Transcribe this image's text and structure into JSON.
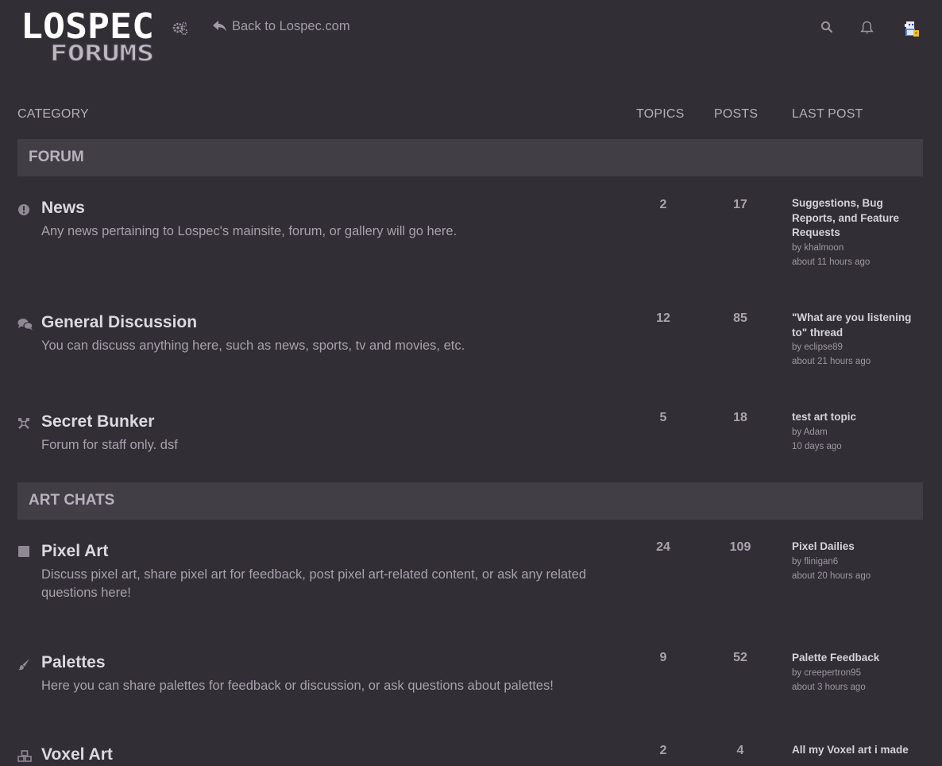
{
  "header": {
    "logo_line1": "LOSPEC",
    "logo_line2": "FORUMS",
    "back_label": "Back to Lospec.com",
    "icons": [
      "settings-icon",
      "search-icon",
      "bell-icon",
      "avatar"
    ]
  },
  "columns": {
    "category": "CATEGORY",
    "topics": "TOPICS",
    "posts": "POSTS",
    "last_post": "LAST POST"
  },
  "sections": [
    {
      "name": "FORUM",
      "categories": [
        {
          "icon": "exclamation-circle-icon",
          "title": "News",
          "description": "Any news pertaining to Lospec's mainsite, forum, or gallery will go here.",
          "topics": "2",
          "posts": "17",
          "last_post": {
            "title": "Suggestions, Bug Reports, and Feature Requests",
            "by": "by",
            "user": "khalmoon",
            "time": "about 11 hours ago"
          }
        },
        {
          "icon": "chat-bubbles-icon",
          "title": "General Discussion",
          "description": "You can discuss anything here, such as news, sports, tv and movies, etc.",
          "topics": "12",
          "posts": "85",
          "last_post": {
            "title": "\"What are you listening to\" thread",
            "by": "by",
            "user": "eclipse89",
            "time": "about 21 hours ago"
          }
        },
        {
          "icon": "crossed-tools-icon",
          "title": "Secret Bunker",
          "description": "Forum for staff only. dsf",
          "topics": "5",
          "posts": "18",
          "last_post": {
            "title": "test art topic",
            "by": "by",
            "user": "Adam",
            "time": "10 days ago"
          }
        }
      ]
    },
    {
      "name": "ART CHATS",
      "categories": [
        {
          "icon": "square-icon",
          "title": "Pixel Art",
          "description": "Discuss pixel art, share pixel art for feedback, post pixel art-related content, or ask any related questions here!",
          "topics": "24",
          "posts": "109",
          "last_post": {
            "title": "Pixel Dailies",
            "by": "by",
            "user": "flinigan6",
            "time": "about 20 hours ago"
          }
        },
        {
          "icon": "paintbrush-icon",
          "title": "Palettes",
          "description": "Here you can share palettes for feedback or discussion, or ask questions about palettes!",
          "topics": "9",
          "posts": "52",
          "last_post": {
            "title": "Palette Feedback",
            "by": "by",
            "user": "creepertron95",
            "time": "about 3 hours ago"
          }
        },
        {
          "icon": "cubes-icon",
          "title": "Voxel Art",
          "description": "",
          "topics": "2",
          "posts": "4",
          "last_post": {
            "title": "All my Voxel art i made",
            "by": "",
            "user": "",
            "time": ""
          }
        }
      ]
    }
  ]
}
